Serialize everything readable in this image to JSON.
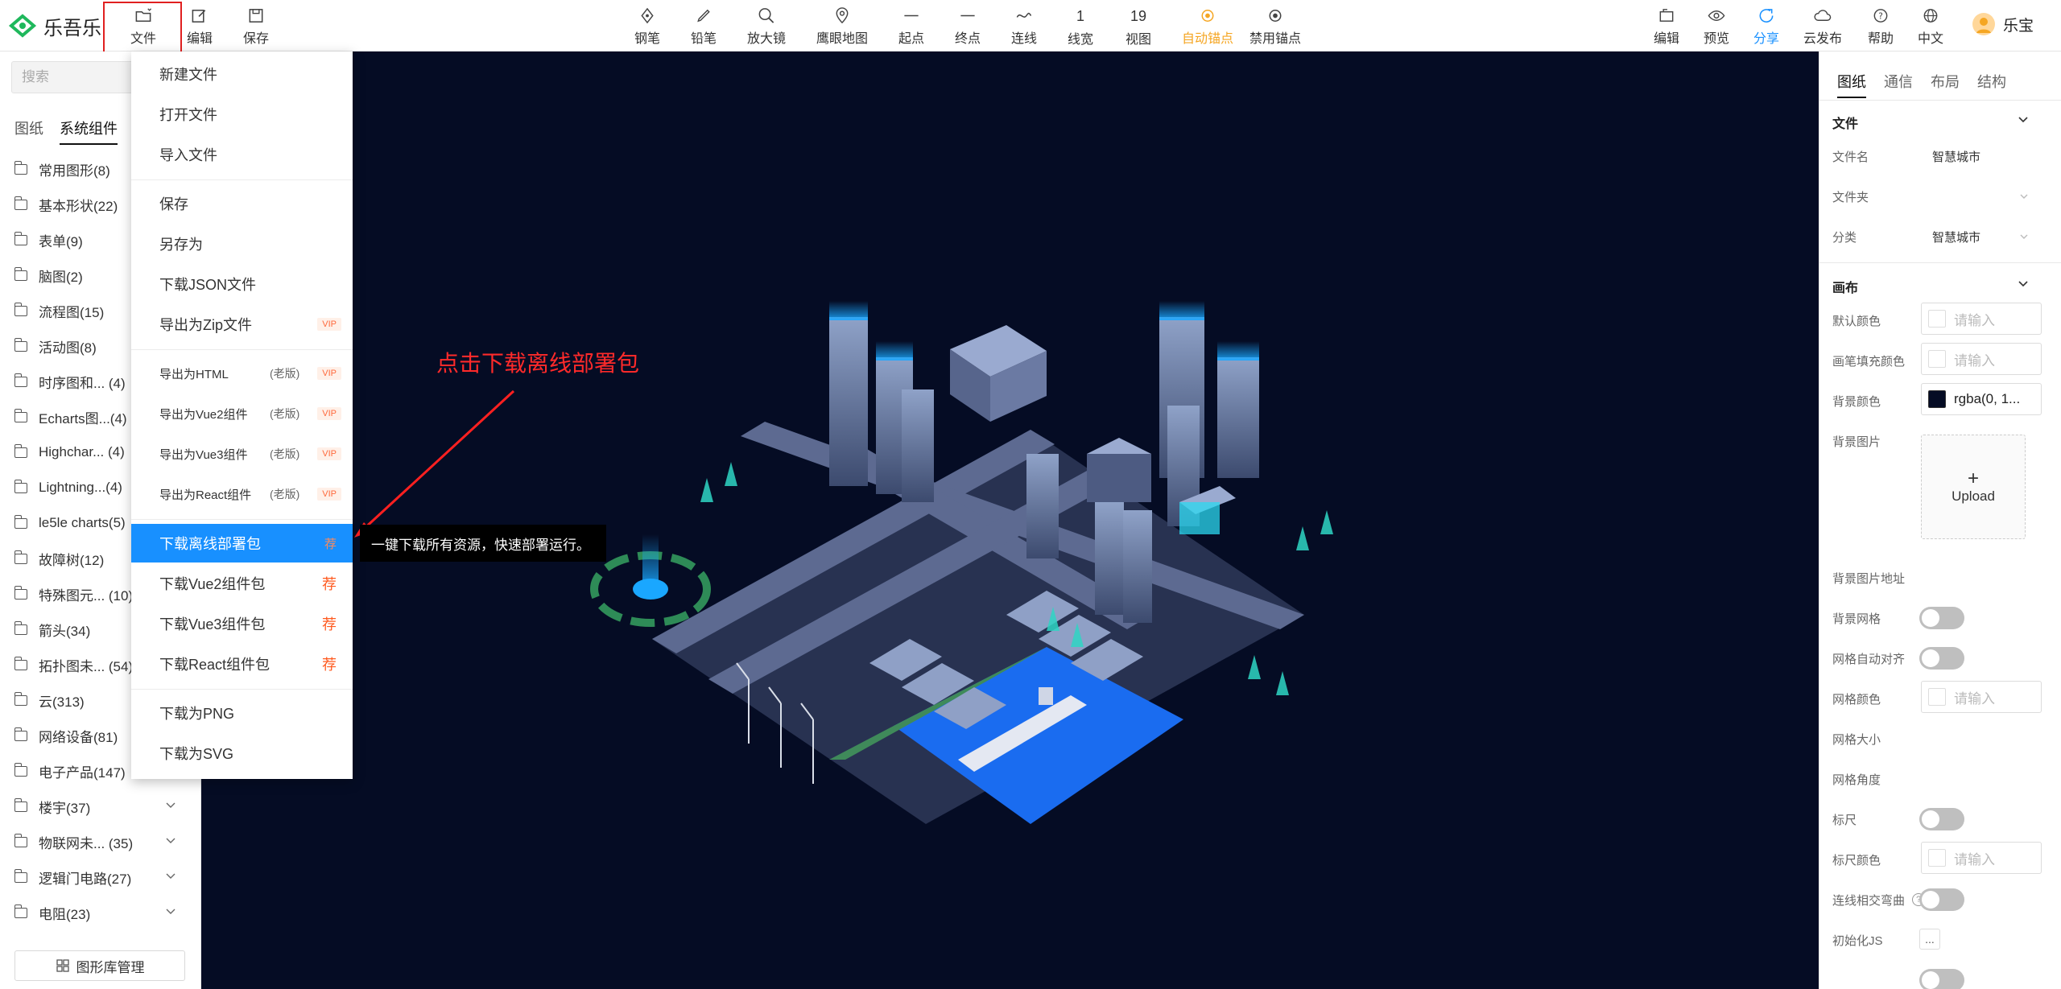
{
  "app": {
    "name": "乐吾乐"
  },
  "toolbar": {
    "left": [
      {
        "id": "file",
        "label": "文件",
        "icon": "folder-icon"
      },
      {
        "id": "edit",
        "label": "编辑",
        "icon": "edit-icon"
      },
      {
        "id": "save",
        "label": "保存",
        "icon": "save-icon"
      }
    ],
    "center": [
      {
        "id": "pen",
        "label": "钢笔",
        "icon": "pen-icon"
      },
      {
        "id": "pencil",
        "label": "铅笔",
        "icon": "pencil-icon"
      },
      {
        "id": "magnifier",
        "label": "放大镜",
        "icon": "magnifier-icon"
      },
      {
        "id": "minimap",
        "label": "鹰眼地图",
        "icon": "location-icon"
      },
      {
        "id": "start",
        "label": "起点",
        "icon": "line-start-icon"
      },
      {
        "id": "end",
        "label": "终点",
        "icon": "line-end-icon"
      },
      {
        "id": "connect",
        "label": "连线",
        "icon": "curve-icon"
      },
      {
        "id": "linewidth",
        "label": "线宽",
        "value": "1"
      },
      {
        "id": "view",
        "label": "视图",
        "value": "19"
      },
      {
        "id": "autoanchor",
        "label": "自动锚点",
        "icon": "anchor-icon"
      },
      {
        "id": "disableanchor",
        "label": "禁用锚点",
        "icon": "anchor-disabled-icon"
      }
    ],
    "right": [
      {
        "id": "edit2",
        "label": "编辑",
        "icon": "edit-icon"
      },
      {
        "id": "preview",
        "label": "预览",
        "icon": "eye-icon"
      },
      {
        "id": "share",
        "label": "分享",
        "icon": "share-icon"
      },
      {
        "id": "publish",
        "label": "云发布",
        "icon": "cloud-icon"
      },
      {
        "id": "help",
        "label": "帮助",
        "icon": "help-icon"
      },
      {
        "id": "lang",
        "label": "中文",
        "icon": "globe-icon"
      }
    ],
    "user": "乐宝"
  },
  "sidebar": {
    "search_placeholder": "搜索",
    "tabs": [
      "图纸",
      "系统组件"
    ],
    "categories": [
      "常用图形(8)",
      "基本形状(22)",
      "表单(9)",
      "脑图(2)",
      "流程图(15)",
      "活动图(8)",
      "时序图和... (4)",
      "Echarts图...(4)",
      "Highchar... (4)",
      "Lightning...(4)",
      "le5le charts(5)",
      "故障树(12)",
      "特殊图元... (10)",
      "箭头(34)",
      "拓扑图未... (54)",
      "云(313)",
      "网络设备(81)",
      "电子产品(147)",
      "楼宇(37)",
      "物联网未... (35)",
      "逻辑门电路(27)",
      "电阻(23)"
    ],
    "library_button": "图形库管理"
  },
  "file_menu": {
    "items": [
      {
        "label": "新建文件"
      },
      {
        "label": "打开文件"
      },
      {
        "label": "导入文件"
      },
      {
        "label": "保存"
      },
      {
        "label": "另存为"
      },
      {
        "label": "下载JSON文件"
      },
      {
        "label": "导出为Zip文件",
        "badge": "VIP"
      },
      {
        "label": "导出为HTML",
        "note": "(老版)",
        "badge": "VIP"
      },
      {
        "label": "导出为Vue2组件",
        "note": "(老版)",
        "badge": "VIP"
      },
      {
        "label": "导出为Vue3组件",
        "note": "(老版)",
        "badge": "VIP"
      },
      {
        "label": "导出为React组件",
        "note": "(老版)",
        "badge": "VIP"
      },
      {
        "label": "下载离线部署包",
        "mark": "荐"
      },
      {
        "label": "下载Vue2组件包",
        "mark": "荐"
      },
      {
        "label": "下载Vue3组件包",
        "mark": "荐"
      },
      {
        "label": "下载React组件包",
        "mark": "荐"
      },
      {
        "label": "下载为PNG"
      },
      {
        "label": "下载为SVG"
      }
    ],
    "tooltip": "一键下载所有资源，快速部署运行。"
  },
  "canvas": {
    "annotation": "点击下载离线部署包",
    "background": "#050c24"
  },
  "props_panel": {
    "tabs": [
      "图纸",
      "通信",
      "布局",
      "结构"
    ],
    "file_section": {
      "title": "文件",
      "filename_label": "文件名",
      "filename": "智慧城市",
      "folder_label": "文件夹",
      "category_label": "分类",
      "category": "智慧城市"
    },
    "canvas_section": {
      "title": "画布",
      "default_color_label": "默认颜色",
      "pen_fill_label": "画笔填充颜色",
      "bg_color_label": "背景颜色",
      "bg_color_value": "rgba(0, 1...",
      "bg_image_label": "背景图片",
      "upload_label": "Upload",
      "bg_image_url_label": "背景图片地址",
      "bg_grid_label": "背景网格",
      "grid_snap_label": "网格自动对齐",
      "grid_color_label": "网格颜色",
      "grid_size_label": "网格大小",
      "grid_angle_label": "网格角度",
      "ruler_label": "标尺",
      "ruler_color_label": "标尺颜色",
      "line_cross_label": "连线相交弯曲",
      "init_js_label": "初始化JS",
      "init_js_button": "...",
      "input_placeholder": "请输入"
    }
  }
}
